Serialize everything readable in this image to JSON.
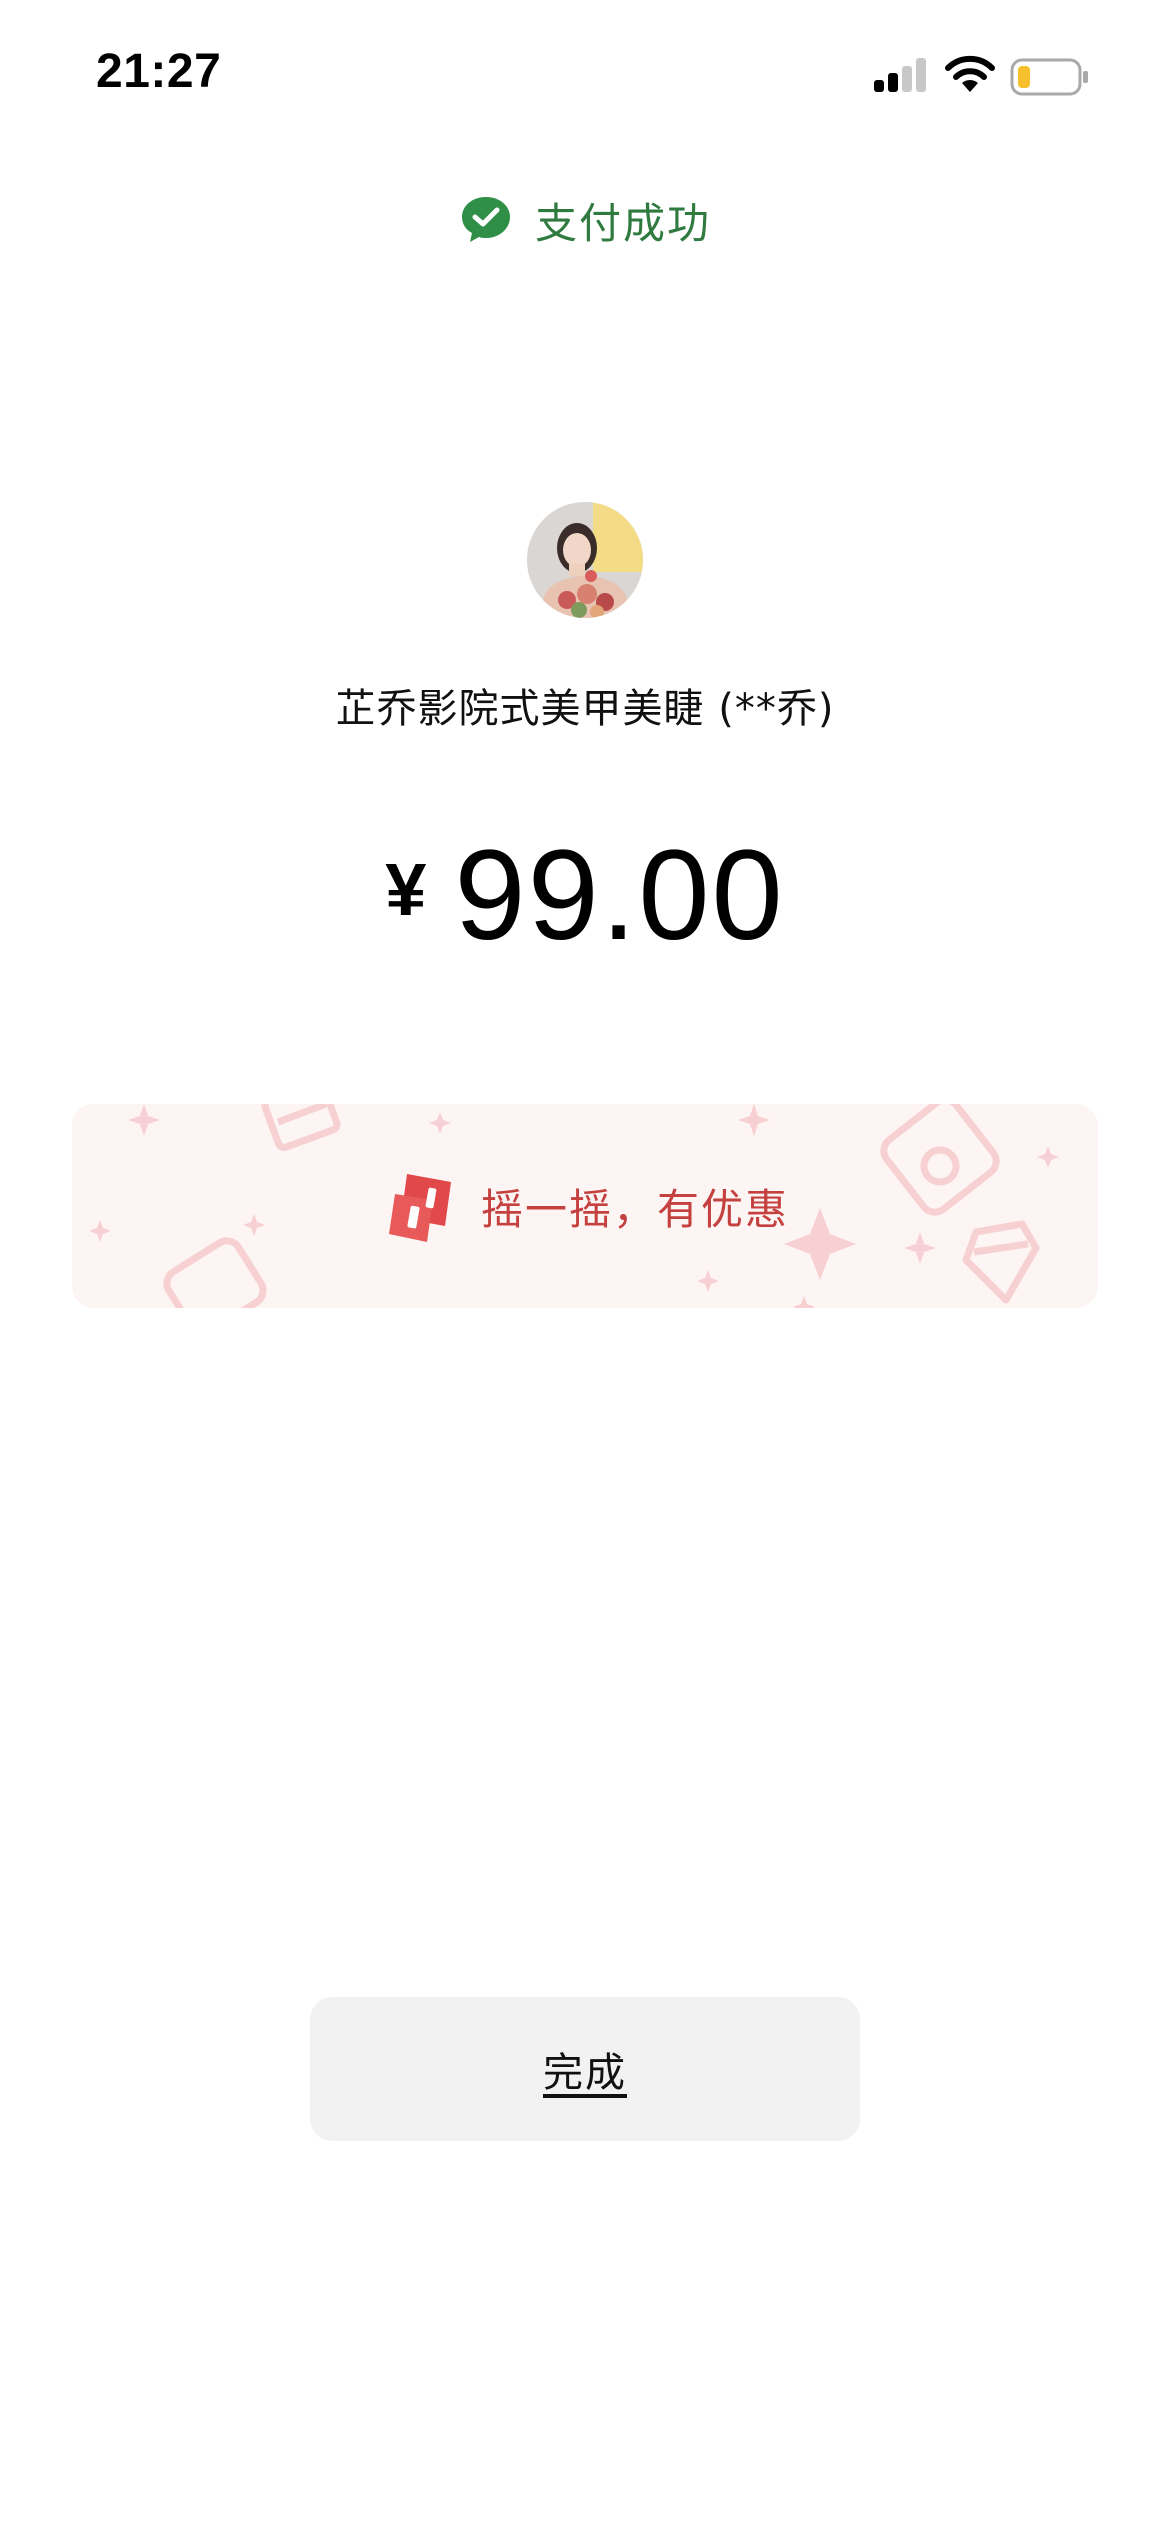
{
  "status_bar": {
    "time": "21:27",
    "icons": [
      "signal-icon",
      "wifi-icon",
      "battery-icon"
    ],
    "battery_color": "#f5c02b"
  },
  "header": {
    "title": "支付成功",
    "icon": "wechat-pay-icon",
    "color": "#2f7a3f"
  },
  "merchant": {
    "name": "芷乔影院式美甲美睫 (**乔)",
    "avatar": "avatar"
  },
  "amount": {
    "currency": "¥",
    "value": "99.00"
  },
  "promo": {
    "text": "摇一摇，有优惠",
    "icon": "shake-coupon-icon",
    "text_color": "#c4413f",
    "background": "#fdf4f4"
  },
  "actions": {
    "done_label": "完成"
  }
}
